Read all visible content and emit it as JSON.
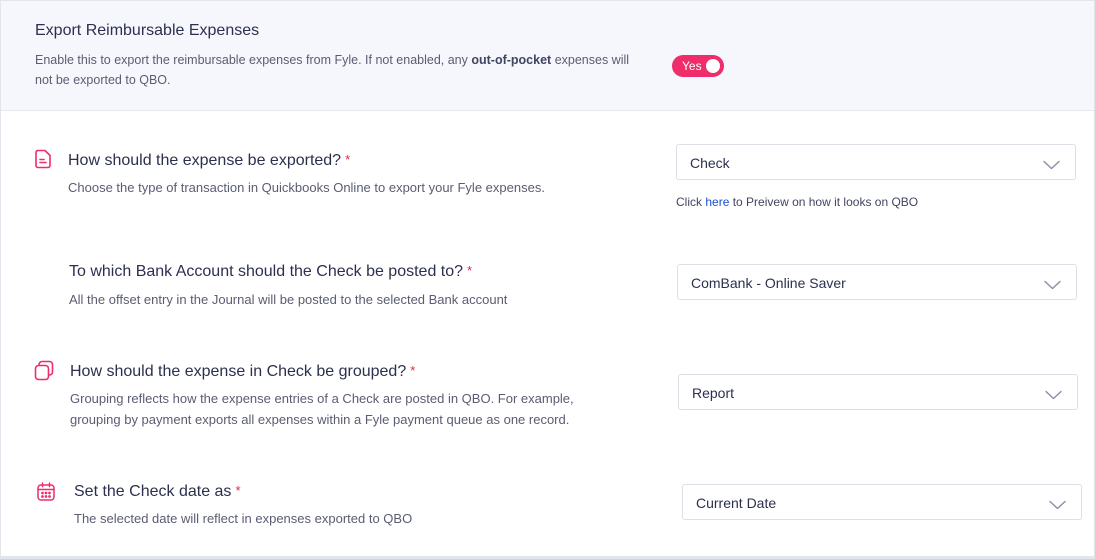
{
  "reimbursable": {
    "title": "Export Reimbursable Expenses",
    "desc_before": "Enable this to export the reimbursable expenses from Fyle. If not enabled, any ",
    "desc_bold": "out-of-pocket",
    "desc_after": " expenses will not be exported to QBO.",
    "toggle_label": "Yes",
    "toggle_on": true
  },
  "export_type": {
    "title": "How should the expense be exported?",
    "required_mark": "*",
    "desc": "Choose the type of transaction in Quickbooks Online to export your Fyle expenses.",
    "value": "Check",
    "preview_before": "Click ",
    "preview_link": "here",
    "preview_after": " to Preivew on how it looks on QBO"
  },
  "bank_account": {
    "title": "To which Bank Account should the Check be posted to?",
    "required_mark": "*",
    "desc": "All the offset entry in the Journal will be posted to the selected Bank account",
    "value": "ComBank - Online Saver"
  },
  "grouping": {
    "title": "How should the expense in Check be grouped?",
    "required_mark": "*",
    "desc_line1": "Grouping reflects how the expense entries of a Check are posted in QBO. For example,",
    "desc_line2": "grouping by payment exports all expenses within a Fyle payment queue as one record.",
    "value": "Report"
  },
  "check_date": {
    "title": "Set the Check date as",
    "required_mark": "*",
    "desc": "The selected date will reflect in expenses exported to QBO",
    "value": "Current Date"
  },
  "colors": {
    "accent": "#ef2d6a",
    "required": "#e2264d",
    "link": "#1a4fcf",
    "panel_bg": "#f5f7fc"
  },
  "icons": {
    "export_type": "document-icon",
    "grouping": "stacked-squares-icon",
    "check_date": "calendar-icon",
    "select": "chevron-down-icon"
  }
}
